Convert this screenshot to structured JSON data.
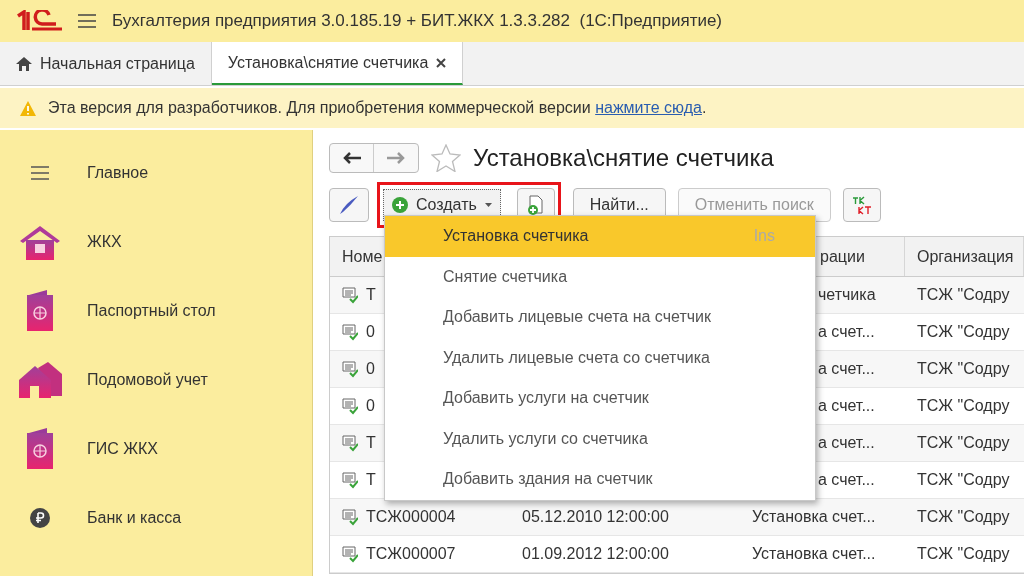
{
  "app_title": "Бухгалтерия предприятия 3.0.185.19 + БИТ.ЖКХ 1.3.3.282  (1С:Предприятие)",
  "tabs": [
    {
      "label": "Начальная страница",
      "selected": false,
      "kind": "home"
    },
    {
      "label": "Установка\\снятие счетчика",
      "selected": true,
      "kind": "doc"
    }
  ],
  "banner": {
    "text": "Эта версия для разработчиков. Для приобретения коммерческой версии",
    "link": "нажмите сюда",
    "tail": "."
  },
  "sidebar": [
    {
      "label": "Главное",
      "kind": "menu"
    },
    {
      "label": "ЖКХ",
      "kind": "house"
    },
    {
      "label": "Паспортный стол",
      "kind": "passport"
    },
    {
      "label": "Подомовой учет",
      "kind": "houses"
    },
    {
      "label": "ГИС ЖКХ",
      "kind": "passport"
    },
    {
      "label": "Банк и касса",
      "kind": "ruble"
    }
  ],
  "form": {
    "title": "Установка\\снятие счетчика",
    "favorite": false
  },
  "toolbar": {
    "create": "Создать",
    "find": "Найти...",
    "cancel_search": "Отменить поиск",
    "cancel_disabled": true
  },
  "table": {
    "columns": [
      "Номе",
      "",
      "рации",
      "Организация"
    ],
    "rows": [
      {
        "number": "Т",
        "operation": "четчика",
        "organization": "ТСЖ \"Содру"
      },
      {
        "number": "0",
        "operation": "а счет...",
        "organization": "ТСЖ \"Содру"
      },
      {
        "number": "0",
        "operation": "а счет...",
        "organization": "ТСЖ \"Содру"
      },
      {
        "number": "0",
        "operation": "а счет...",
        "organization": "ТСЖ \"Содру"
      },
      {
        "number": "Т",
        "operation": "а счет...",
        "organization": "ТСЖ \"Содру"
      },
      {
        "number": "Т",
        "operation": "а счет...",
        "organization": "ТСЖ \"Содру"
      },
      {
        "number": "ТСЖ000004",
        "date": "05.12.2010 12:00:00",
        "operation": "Установка счет...",
        "organization": "ТСЖ \"Содру"
      },
      {
        "number": "ТСЖ000007",
        "date": "01.09.2012 12:00:00",
        "operation": "Установка счет...",
        "organization": "ТСЖ \"Содру"
      }
    ]
  },
  "create_menu": [
    {
      "label": "Установка счетчика",
      "shortcut": "Ins",
      "selected": true
    },
    {
      "label": "Снятие счетчика",
      "selected": false
    },
    {
      "label": "Добавить лицевые счета на счетчик",
      "selected": false
    },
    {
      "label": "Удалить лицевые счета со счетчика",
      "selected": false
    },
    {
      "label": "Добавить услуги на счетчик",
      "selected": false
    },
    {
      "label": "Удалить услуги со счетчика",
      "selected": false
    },
    {
      "label": "Добавить здания на счетчик",
      "selected": false
    }
  ]
}
